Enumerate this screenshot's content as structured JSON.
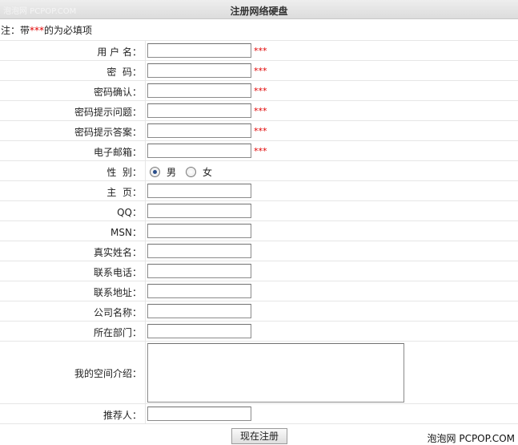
{
  "header": {
    "title": "注册网络硬盘",
    "watermark": "泡泡网 PCPOP.COM"
  },
  "note": {
    "prefix": "注：带",
    "stars": "***",
    "suffix": "的为必填项"
  },
  "required_mark": "***",
  "fields": {
    "username": "用 户 名：",
    "password": "密  码：",
    "confirm": "密码确认：",
    "question": "密码提示问题：",
    "answer": "密码提示答案：",
    "email": "电子邮箱：",
    "gender": "性  别：",
    "homepage": "主  页：",
    "qq": "QQ：",
    "msn": "MSN：",
    "realname": "真实姓名：",
    "phone": "联系电话：",
    "address": "联系地址：",
    "company": "公司名称：",
    "department": "所在部门：",
    "intro": "我的空间介绍：",
    "referrer": "推荐人："
  },
  "gender": {
    "male": "男",
    "female": "女",
    "selected": "男"
  },
  "submit_label": "现在注册",
  "footer_credit": "泡泡网 PCPOP.COM"
}
